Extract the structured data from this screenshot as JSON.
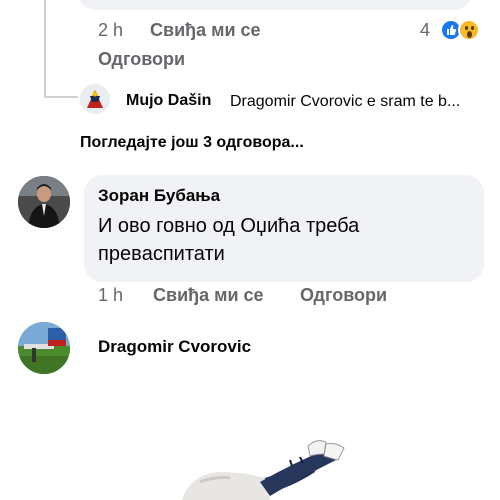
{
  "previous_comment": {
    "time": "2 h",
    "like_label": "Свиђа ми се",
    "reply_label": "Одговори",
    "reaction_count": "4",
    "reactions": [
      "like-icon",
      "wow-icon"
    ]
  },
  "nested_reply": {
    "author": "Mujo Dašin",
    "text": "Dragomir Cvorovic e sram te b..."
  },
  "view_more_replies": "Погледајте још 3 одговора...",
  "comment": {
    "author": "Зоран Бубања",
    "text": "И ово говно од Оџића треба превaспитати",
    "time": "1 h",
    "like_label": "Свиђа ми се",
    "reply_label": "Одговори"
  },
  "next_comment": {
    "author": "Dragomir Cvorovic"
  },
  "colors": {
    "bubble": "#f0f2f5",
    "meta_text": "#65676b",
    "like_blue": "#1877f2",
    "wow_yellow": "#f7b928"
  }
}
